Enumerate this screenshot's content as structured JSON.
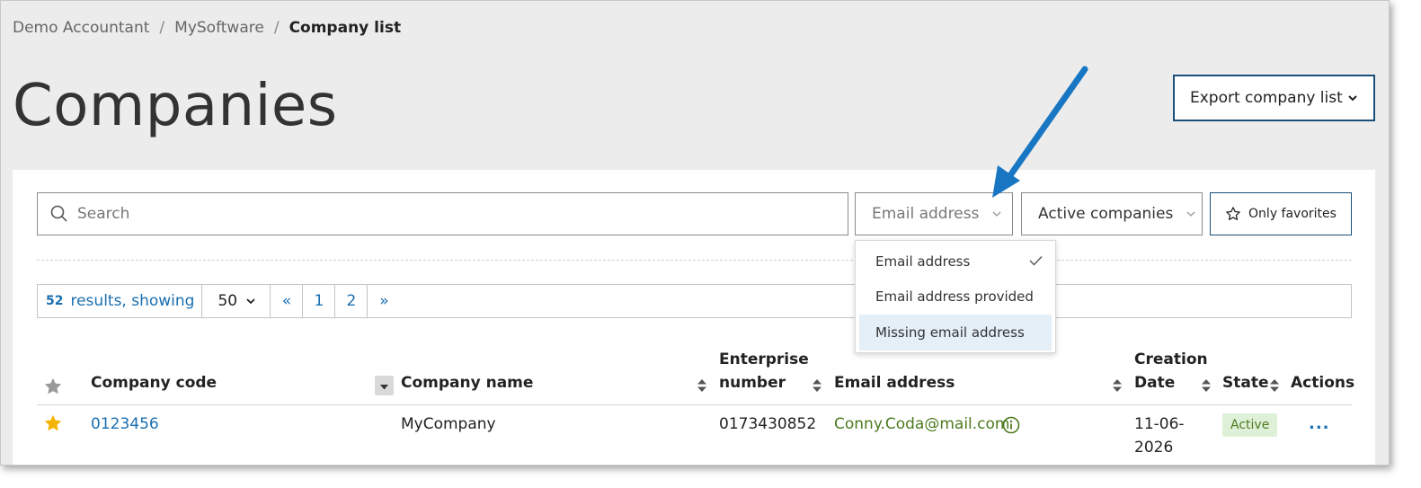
{
  "breadcrumb": {
    "items": [
      "Demo Accountant",
      "MySoftware"
    ],
    "current": "Company list",
    "separator": "/"
  },
  "page_title": "Companies",
  "export_button": {
    "label": "Export company list",
    "icon": "chevron-down-icon"
  },
  "filters": {
    "search_placeholder": "Search",
    "email_select": "Email address",
    "state_select": "Active companies",
    "favorites_button": "Only favorites"
  },
  "email_dropdown": {
    "options": [
      "Email address",
      "Email address provided",
      "Missing email address"
    ],
    "selected_index": 0,
    "highlighted_index": 2
  },
  "pager": {
    "count": "52",
    "results_label": "results, showing",
    "per_page": "50",
    "first": "«",
    "pages": [
      "1",
      "2"
    ],
    "last": "»"
  },
  "table": {
    "headers": {
      "company_code": "Company code",
      "company_name": "Company name",
      "enterprise_number_line1": "Enterprise",
      "enterprise_number_line2": "number",
      "email": "Email address",
      "creation_line1": "Creation",
      "creation_line2": "Date",
      "state": "State",
      "actions": "Actions"
    },
    "rows": [
      {
        "favorite": true,
        "company_code": "0123456",
        "company_name": "MyCompany",
        "enterprise_number": "0173430852",
        "email": "Conny.Coda@mail.com",
        "creation_line1": "11-06-",
        "creation_line2": "2026",
        "state": "Active",
        "actions": "..."
      }
    ]
  },
  "colors": {
    "accent_blue": "#1a6fb0",
    "button_border": "#1a4f7a",
    "annotation_arrow": "#1976c2",
    "active_green": "#4d7a1f",
    "favorite_star": "#f5b301"
  }
}
